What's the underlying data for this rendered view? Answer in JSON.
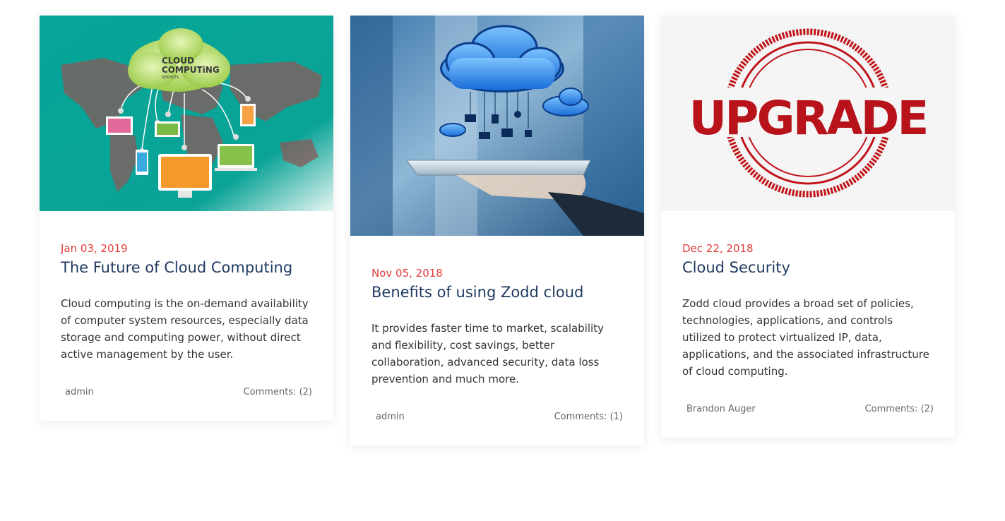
{
  "posts": [
    {
      "date": "Jan 03, 2019",
      "title": "The Future of Cloud Computing",
      "excerpt": "Cloud computing is the on-demand availability of computer system resources, especially data storage and computing power, without direct active management by the user.",
      "author": "admin",
      "comments": "Comments: (2)",
      "image_text_1": "CLOUD",
      "image_text_2": "COMPUTiNG",
      "image_text_3": "SERVICES"
    },
    {
      "date": "Nov 05, 2018",
      "title": "Benefits of using Zodd cloud",
      "excerpt": "It provides faster time to market, scalability and flexibility, cost savings, better collaboration, advanced security, data loss prevention and much more.",
      "author": "admin",
      "comments": "Comments: (1)"
    },
    {
      "date": "Dec 22, 2018",
      "title": "Cloud Security",
      "excerpt": "Zodd cloud provides a broad set of policies, technologies, applications, and controls utilized to protect virtualized IP, data, applications, and the associated infrastructure of cloud computing.",
      "author": "Brandon Auger",
      "comments": "Comments: (2)",
      "image_text": "UPGRADE"
    }
  ],
  "colors": {
    "date": "#e03b3b",
    "title": "#1f3a5f",
    "teal": "#07a89b"
  }
}
